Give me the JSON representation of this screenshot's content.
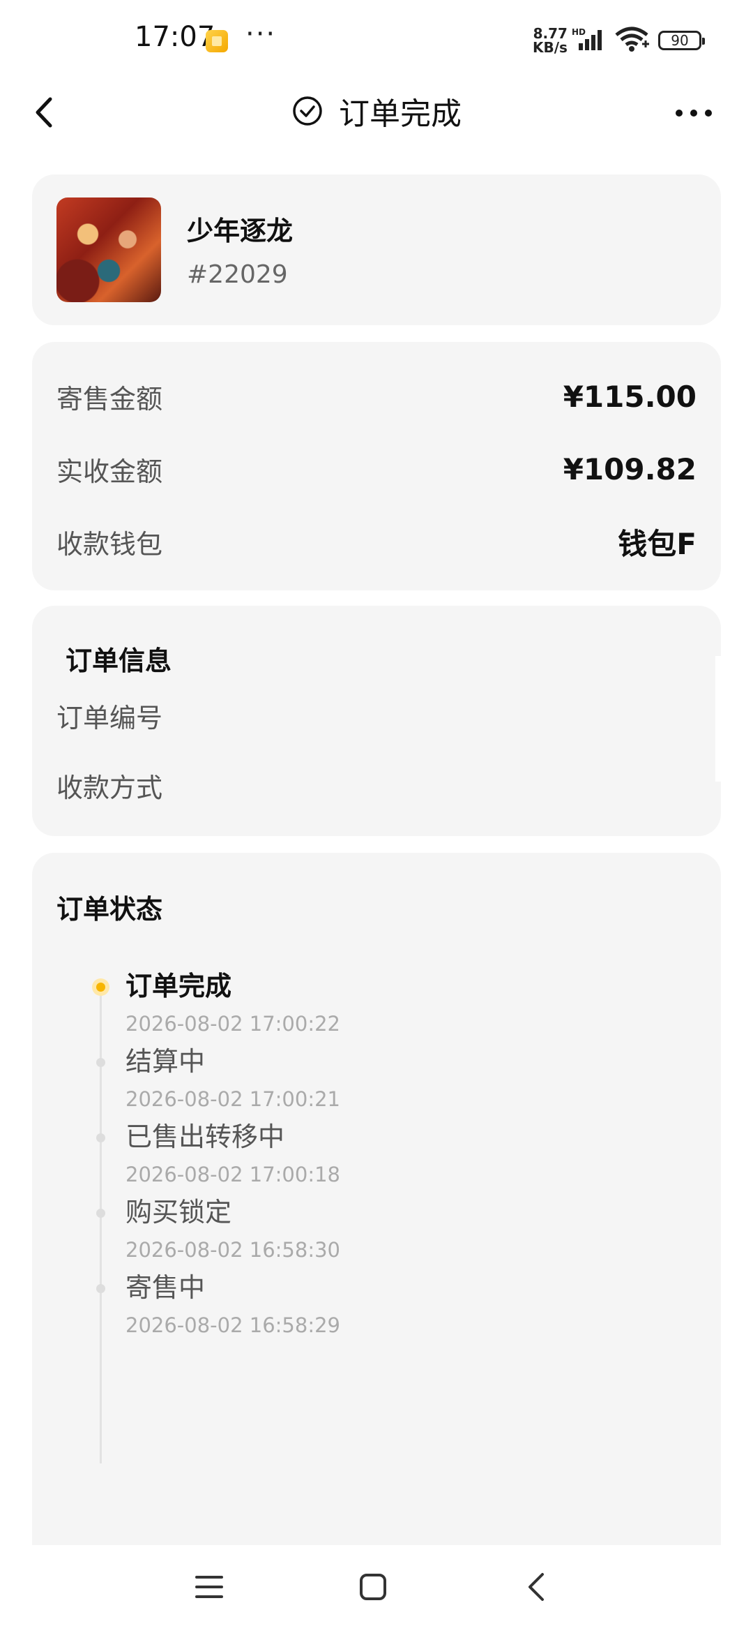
{
  "status_bar": {
    "time": "17:07",
    "dots": "···",
    "net_speed_value": "8.77",
    "net_speed_unit": "KB/s",
    "hd_label": "HD",
    "battery": "90",
    "icons": [
      "notification-icon",
      "signal-icon",
      "wifi-icon",
      "battery-icon"
    ]
  },
  "header": {
    "title": "订单完成",
    "back_icon": "chevron-left-icon",
    "status_icon": "check-circle-icon",
    "more_icon": "more-dots-icon"
  },
  "product": {
    "name": "少年逐龙",
    "id": "#22029",
    "cover_icon": "product-cover-image"
  },
  "amounts": [
    {
      "label": "寄售金额",
      "value": "¥115.00"
    },
    {
      "label": "实收金额",
      "value": "¥109.82"
    },
    {
      "label": "收款钱包",
      "value": "钱包F"
    }
  ],
  "order_info": {
    "heading": "订单信息",
    "rows": [
      {
        "label": "订单编号",
        "value": ""
      },
      {
        "label": "收款方式",
        "value": ""
      }
    ]
  },
  "order_status": {
    "heading": "订单状态",
    "steps": [
      {
        "title": "订单完成",
        "time": "2026-08-02 17:00:22",
        "active": true
      },
      {
        "title": "结算中",
        "time": "2026-08-02 17:00:21",
        "active": false
      },
      {
        "title": "已售出转移中",
        "time": "2026-08-02 17:00:18",
        "active": false
      },
      {
        "title": "购买锁定",
        "time": "2026-08-02 16:58:30",
        "active": false
      },
      {
        "title": "寄售中",
        "time": "2026-08-02 16:58:29",
        "active": false
      }
    ]
  },
  "system_nav": {
    "icons": [
      "menu-icon",
      "home-square-icon",
      "back-arrow-icon"
    ]
  },
  "colors": {
    "card_bg": "#f5f5f5",
    "accent": "#f7b500",
    "muted_text": "#aaaaaa"
  }
}
